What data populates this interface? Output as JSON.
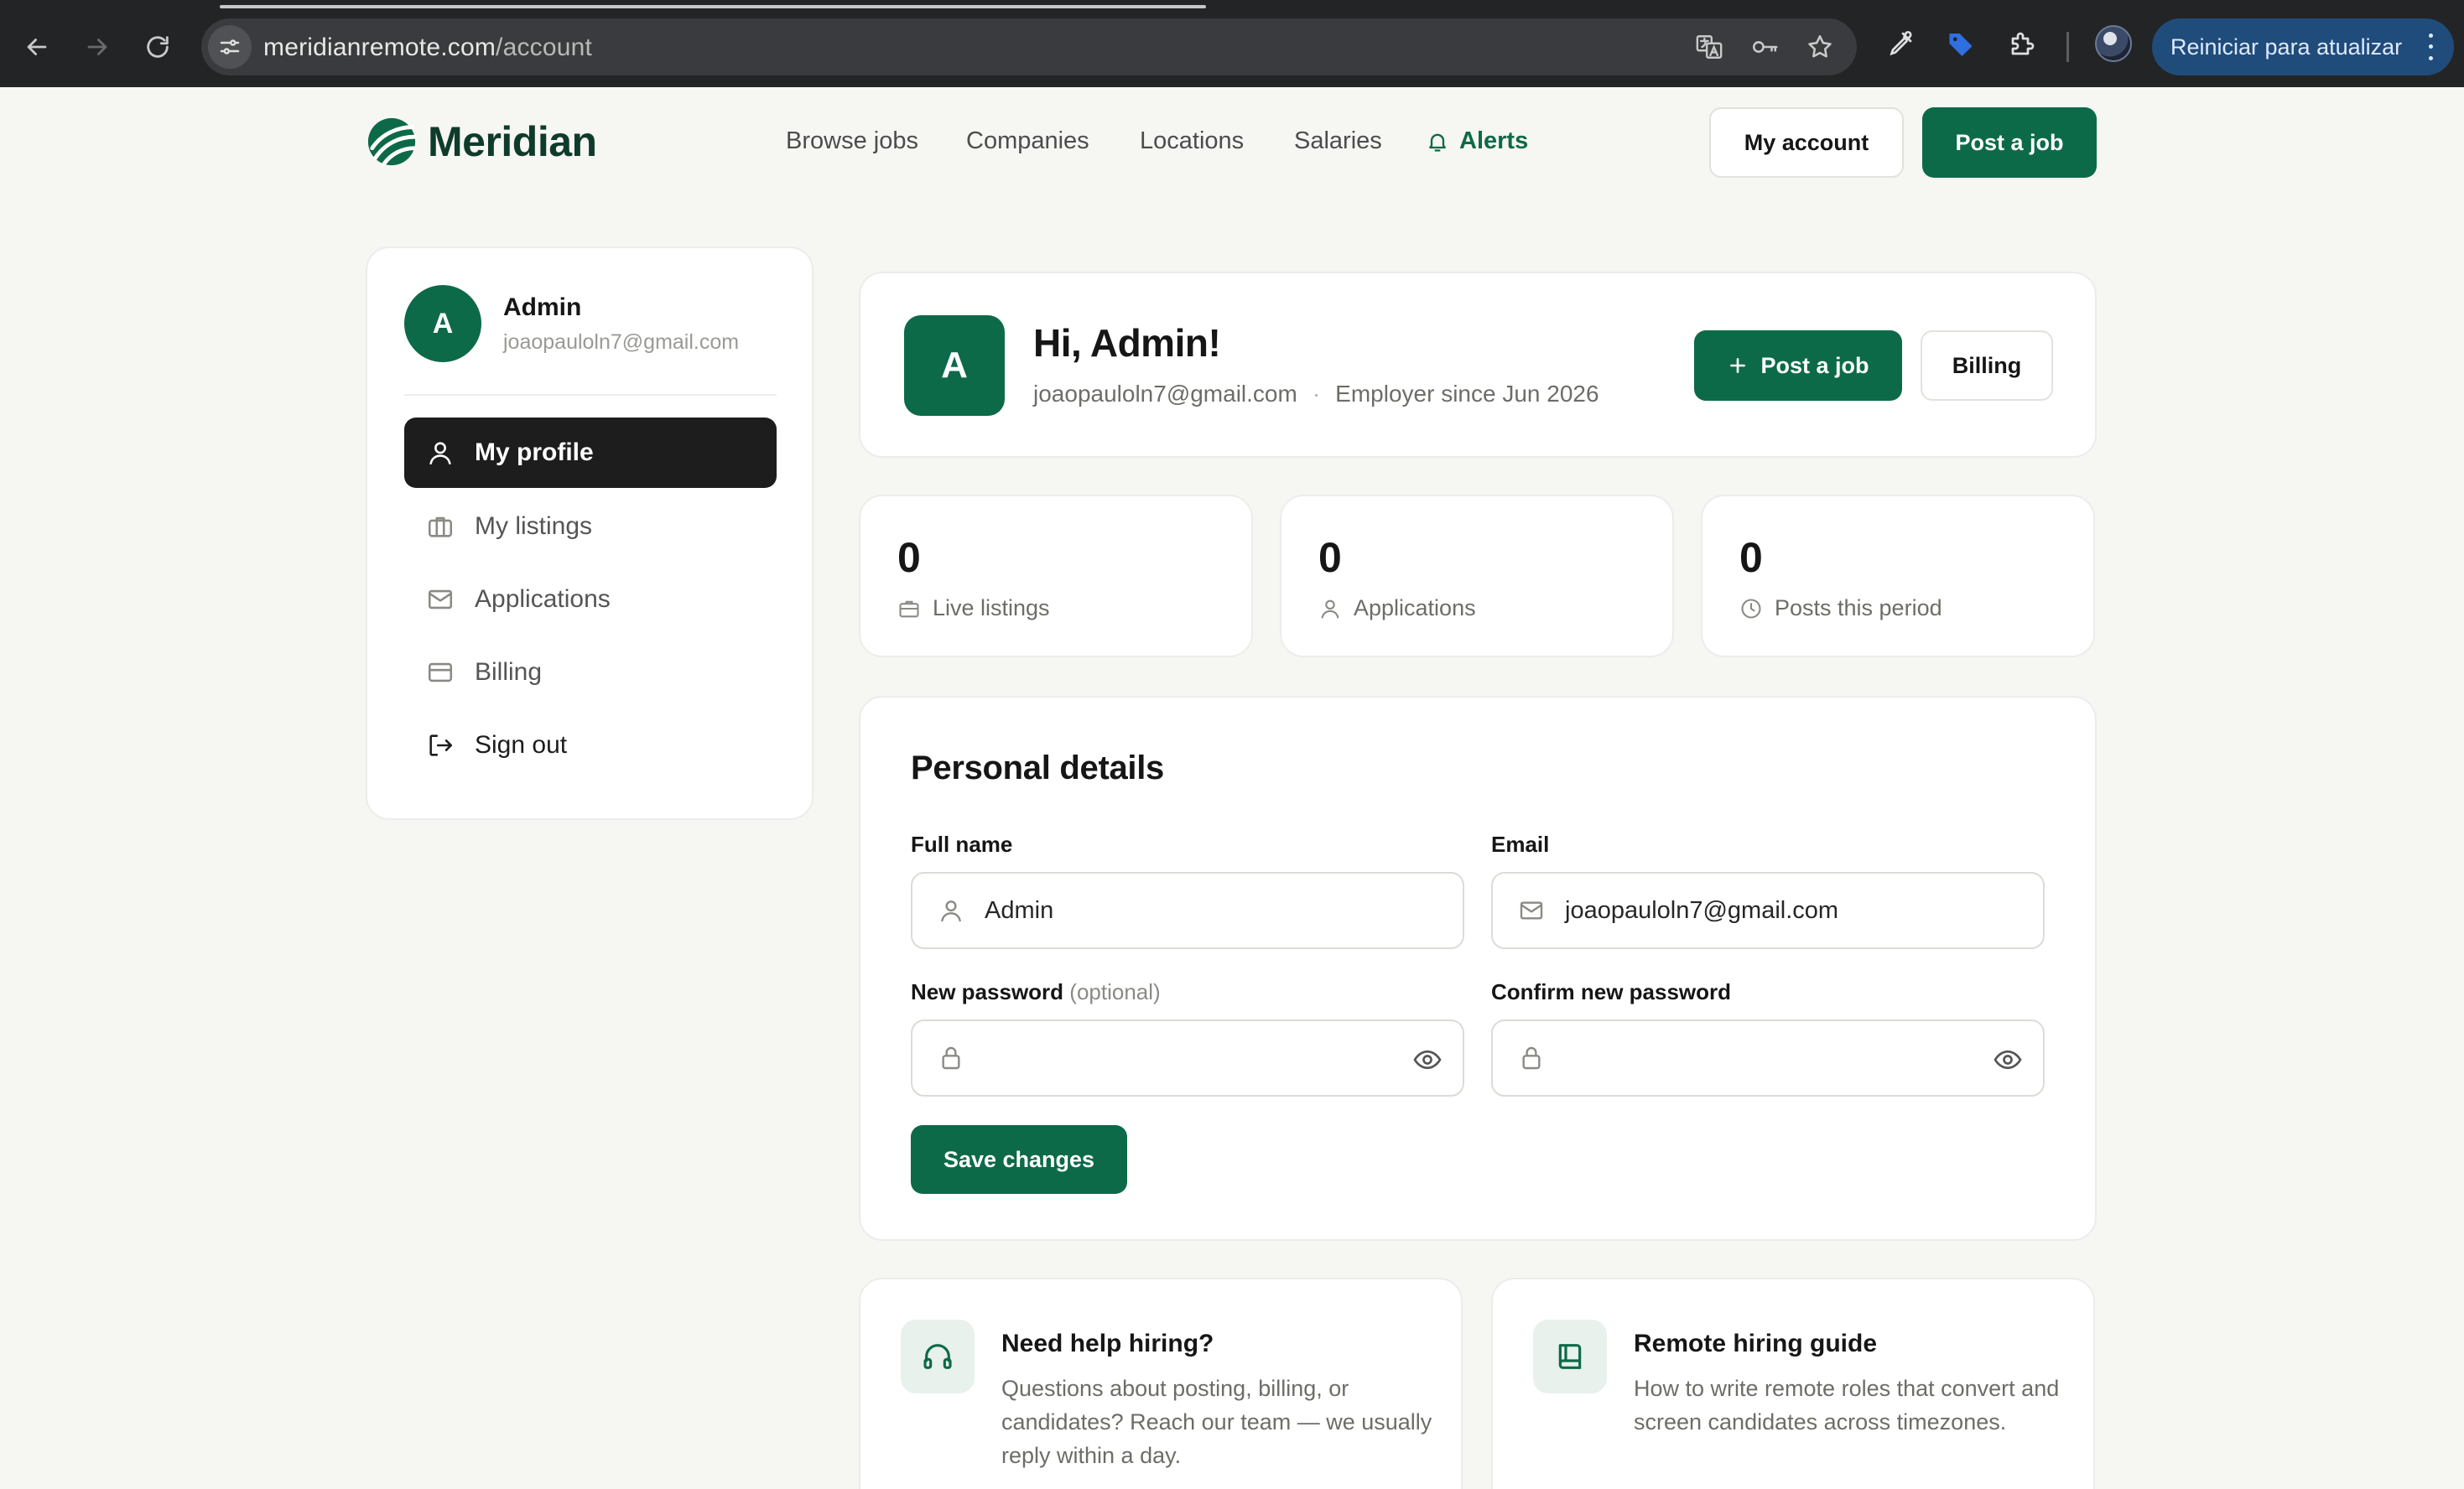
{
  "browser": {
    "url_host": "meridianremote.com",
    "url_path": "/account",
    "update_button_label": "Reiniciar para atualizar"
  },
  "site": {
    "brand_name": "Meridian",
    "nav": {
      "browse_jobs": "Browse jobs",
      "companies": "Companies",
      "locations": "Locations",
      "salaries": "Salaries",
      "alerts": "Alerts"
    },
    "my_account_label": "My account",
    "post_job_label": "Post a job"
  },
  "sidebar": {
    "avatar_initial": "A",
    "user_name": "Admin",
    "user_email": "joaopauloln7@gmail.com",
    "items": [
      {
        "label": "My profile",
        "icon": "user-icon",
        "active": true
      },
      {
        "label": "My listings",
        "icon": "briefcase-icon",
        "active": false
      },
      {
        "label": "Applications",
        "icon": "mail-icon",
        "active": false
      },
      {
        "label": "Billing",
        "icon": "credit-card-icon",
        "active": false
      },
      {
        "label": "Sign out",
        "icon": "sign-out-icon",
        "active": false
      }
    ]
  },
  "hero": {
    "avatar_initial": "A",
    "greeting": "Hi, Admin!",
    "email": "joaopauloln7@gmail.com",
    "separator": "·",
    "employer_since": "Employer since Jun 2026",
    "post_job_label": "Post a job",
    "billing_label": "Billing"
  },
  "stats": [
    {
      "value": "0",
      "label": "Live listings",
      "icon": "briefcase-icon"
    },
    {
      "value": "0",
      "label": "Applications",
      "icon": "user-icon"
    },
    {
      "value": "0",
      "label": "Posts this period",
      "icon": "clock-icon"
    }
  ],
  "personal_details": {
    "title": "Personal details",
    "full_name_label": "Full name",
    "full_name_value": "Admin",
    "email_label": "Email",
    "email_value": "joaopauloln7@gmail.com",
    "new_password_label": "New password",
    "new_password_optional": "(optional)",
    "confirm_password_label": "Confirm new password",
    "save_label": "Save changes"
  },
  "help_cards": [
    {
      "title": "Need help hiring?",
      "description": "Questions about posting, billing, or candidates? Reach our team — we usually reply within a day.",
      "icon": "headphones-icon"
    },
    {
      "title": "Remote hiring guide",
      "description": "How to write remote roles that convert and screen candidates across timezones.",
      "icon": "book-icon"
    }
  ],
  "colors": {
    "brand_green": "#0d6a49",
    "page_background": "#f6f6f3",
    "active_nav_background": "#1d1d1d",
    "browser_chrome": "#232426"
  }
}
